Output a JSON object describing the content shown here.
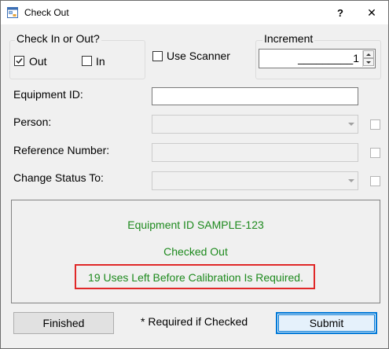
{
  "window": {
    "title": "Check Out",
    "help_glyph": "?",
    "close_glyph": "✕"
  },
  "check_group": {
    "title": "Check In or Out?",
    "out_label": "Out",
    "out_checked": true,
    "in_label": "In",
    "in_checked": false
  },
  "scanner": {
    "label": "Use Scanner",
    "checked": false
  },
  "increment": {
    "title": "Increment",
    "value": "_________1"
  },
  "form": {
    "equipment_id_label": "Equipment ID:",
    "equipment_id_value": "",
    "person_label": "Person:",
    "person_value": "",
    "reference_label": "Reference Number:",
    "reference_value": "",
    "status_label": "Change Status To:",
    "status_value": ""
  },
  "status": {
    "line1": "Equipment ID SAMPLE-123",
    "line2": "Checked Out",
    "line3": "19 Uses Left Before Calibration Is Required.",
    "text_color": "#1e8a1e",
    "highlight_color": "#e02828"
  },
  "footer": {
    "finished_label": "Finished",
    "note": "* Required if Checked",
    "submit_label": "Submit"
  },
  "icons": {
    "app": "window-form-icon",
    "check": "checkmark-icon"
  }
}
